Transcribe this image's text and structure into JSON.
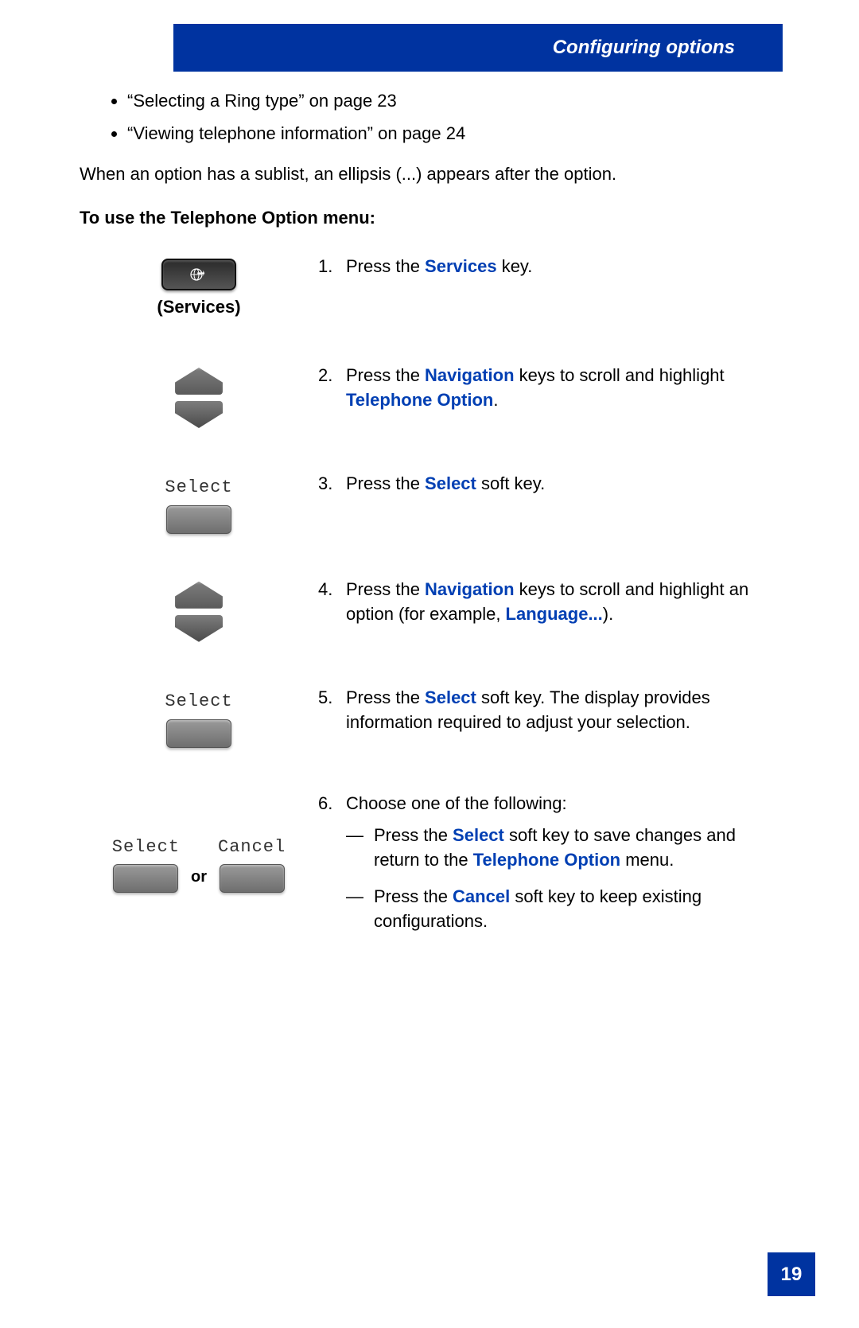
{
  "header": {
    "title": "Configuring options"
  },
  "intro": {
    "bullets": [
      "“Selecting a Ring type” on page 23",
      "“Viewing telephone information” on page 24"
    ],
    "para": "When an option has a sublist, an ellipsis (...) appears after the option.",
    "heading": "To use the Telephone Option menu:"
  },
  "labels": {
    "services_caption": "(Services)",
    "select_label": "Select",
    "cancel_label": "Cancel",
    "or": "or"
  },
  "steps": {
    "s1": {
      "num": "1.",
      "pre": "Press the ",
      "kw": "Services",
      "post": " key."
    },
    "s2": {
      "num": "2.",
      "pre": "Press the ",
      "kw1": "Navigation",
      "mid": " keys to scroll and highlight ",
      "kw2": "Telephone Option",
      "post": "."
    },
    "s3": {
      "num": "3.",
      "pre": "Press the ",
      "kw": "Select",
      "post": " soft key."
    },
    "s4": {
      "num": "4.",
      "pre": "Press the ",
      "kw1": "Navigation",
      "mid": " keys to scroll and highlight an option (for example, ",
      "kw2": "Language...",
      "post": ")."
    },
    "s5": {
      "num": "5.",
      "pre": "Press the ",
      "kw": "Select",
      "post": " soft key. The display provides information required to adjust your selection."
    },
    "s6": {
      "num": "6.",
      "intro": "Choose one of the following:",
      "a": {
        "pre": "Press the ",
        "kw1": "Select",
        "mid": " soft key to save changes and return to the ",
        "kw2": "Telephone Option",
        "post": " menu."
      },
      "b": {
        "pre": "Press the ",
        "kw": "Cancel",
        "post": " soft key to keep existing configurations."
      }
    }
  },
  "page_number": "19"
}
